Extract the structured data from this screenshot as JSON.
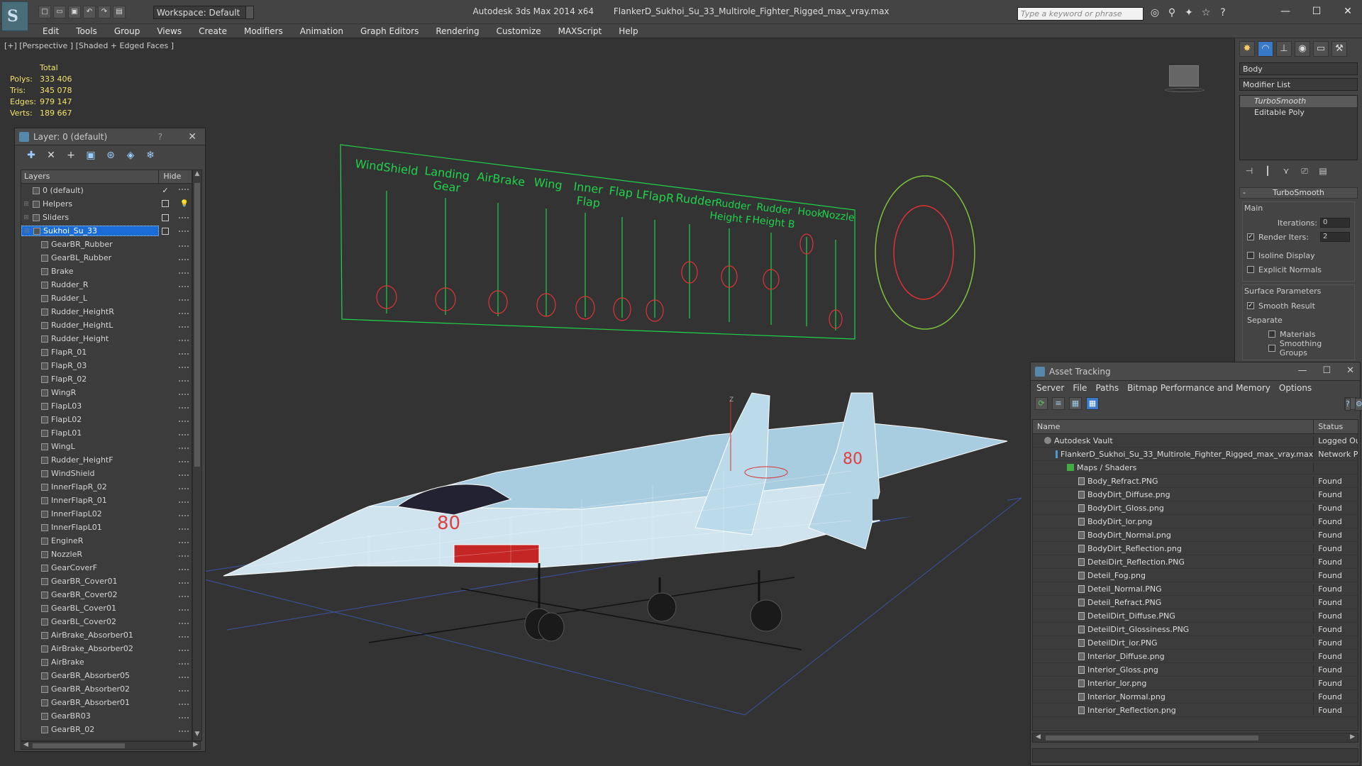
{
  "app": {
    "title": "Autodesk 3ds Max  2014 x64",
    "file": "FlankerD_Sukhoi_Su_33_Multirole_Fighter_Rigged_max_vray.max",
    "workspace": "Workspace: Default",
    "search_placeholder": "Type a keyword or phrase"
  },
  "menu": [
    "Edit",
    "Tools",
    "Group",
    "Views",
    "Create",
    "Modifiers",
    "Animation",
    "Graph Editors",
    "Rendering",
    "Customize",
    "MAXScript",
    "Help"
  ],
  "viewport": {
    "label": "[+] [Perspective ] [Shaded + Edged Faces ]",
    "stats_header": "Total",
    "stats": [
      {
        "k": "Polys:",
        "v": "333 406"
      },
      {
        "k": "Tris:",
        "v": "345 078"
      },
      {
        "k": "Edges:",
        "v": "979 147"
      },
      {
        "k": "Verts:",
        "v": "189 667"
      }
    ],
    "rig_labels": [
      "WindShield",
      "Landing",
      "Gear",
      "AirBrake",
      "Wing",
      "Inner",
      "Flap",
      "Flap L",
      "FlapR",
      "Rudder",
      "Rudder",
      "Height F",
      "Rudder",
      "Height B",
      "Hook",
      "Nozzle"
    ],
    "aircraft_number": "80",
    "axis_label": "Z"
  },
  "layer_panel": {
    "title": "Layer: 0 (default)",
    "help": "?",
    "col_layers": "Layers",
    "col_hide": "Hide",
    "rows": [
      {
        "name": "0 (default)",
        "level": 0,
        "check": "✓",
        "hide": ""
      },
      {
        "name": "Helpers",
        "level": 0,
        "check": "",
        "hide": "bulb"
      },
      {
        "name": "Sliders",
        "level": 0,
        "check": "",
        "hide": ""
      },
      {
        "name": "Sukhoi_Su_33",
        "level": 0,
        "check": "",
        "hide": "",
        "selected": true
      },
      {
        "name": "GearBR_Rubber",
        "level": 1
      },
      {
        "name": "GearBL_Rubber",
        "level": 1
      },
      {
        "name": "Brake",
        "level": 1
      },
      {
        "name": "Rudder_R",
        "level": 1
      },
      {
        "name": "Rudder_L",
        "level": 1
      },
      {
        "name": "Rudder_HeightR",
        "level": 1
      },
      {
        "name": "Rudder_HeightL",
        "level": 1
      },
      {
        "name": "Rudder_Height",
        "level": 1
      },
      {
        "name": "FlapR_01",
        "level": 1
      },
      {
        "name": "FlapR_03",
        "level": 1
      },
      {
        "name": "FlapR_02",
        "level": 1
      },
      {
        "name": "WingR",
        "level": 1
      },
      {
        "name": "FlapL03",
        "level": 1
      },
      {
        "name": "FlapL02",
        "level": 1
      },
      {
        "name": "FlapL01",
        "level": 1
      },
      {
        "name": "WingL",
        "level": 1
      },
      {
        "name": "Rudder_HeightF",
        "level": 1
      },
      {
        "name": "WindShield",
        "level": 1
      },
      {
        "name": "InnerFlapR_02",
        "level": 1
      },
      {
        "name": "InnerFlapR_01",
        "level": 1
      },
      {
        "name": "InnerFlapL02",
        "level": 1
      },
      {
        "name": "InnerFlapL01",
        "level": 1
      },
      {
        "name": "EngineR",
        "level": 1
      },
      {
        "name": "NozzleR",
        "level": 1
      },
      {
        "name": "GearCoverF",
        "level": 1
      },
      {
        "name": "GearBR_Cover01",
        "level": 1
      },
      {
        "name": "GearBR_Cover02",
        "level": 1
      },
      {
        "name": "GearBL_Cover01",
        "level": 1
      },
      {
        "name": "GearBL_Cover02",
        "level": 1
      },
      {
        "name": "AirBrake_Absorber01",
        "level": 1
      },
      {
        "name": "AirBrake_Absorber02",
        "level": 1
      },
      {
        "name": "AirBrake",
        "level": 1
      },
      {
        "name": "GearBR_Absorber05",
        "level": 1
      },
      {
        "name": "GearBR_Absorber02",
        "level": 1
      },
      {
        "name": "GearBR_Absorber01",
        "level": 1
      },
      {
        "name": "GearBR03",
        "level": 1
      },
      {
        "name": "GearBR_02",
        "level": 1
      }
    ]
  },
  "command_panel": {
    "object_name": "Body",
    "modifier_list": "Modifier List",
    "stack": [
      {
        "name": "TurboSmooth",
        "selected": true
      },
      {
        "name": "Editable Poly",
        "selected": false
      }
    ],
    "rollout": "TurboSmooth",
    "main_group": "Main",
    "iterations_label": "Iterations:",
    "iterations_value": "0",
    "render_iters_label": "Render Iters:",
    "render_iters_value": "2",
    "isoline": "Isoline Display",
    "explicit_normals": "Explicit Normals",
    "surface_group": "Surface Parameters",
    "smooth_result": "Smooth Result",
    "separate": "Separate",
    "materials": "Materials",
    "smoothing_groups": "Smoothing Groups"
  },
  "asset_tracking": {
    "title": "Asset Tracking",
    "menu": [
      "Server",
      "File",
      "Paths",
      "Bitmap Performance and Memory",
      "Options"
    ],
    "col_name": "Name",
    "col_status": "Status",
    "rows": [
      {
        "name": "Autodesk Vault",
        "status": "Logged Out",
        "type": "vault",
        "indent": 1
      },
      {
        "name": "FlankerD_Sukhoi_Su_33_Multirole_Fighter_Rigged_max_vray.max",
        "status": "Network Path",
        "type": "max",
        "indent": 2
      },
      {
        "name": "Maps / Shaders",
        "status": "",
        "type": "group",
        "indent": 3
      },
      {
        "name": "Body_Refract.PNG",
        "status": "Found",
        "type": "file",
        "indent": 4
      },
      {
        "name": "BodyDirt_Diffuse.png",
        "status": "Found",
        "type": "file",
        "indent": 4
      },
      {
        "name": "BodyDirt_Gloss.png",
        "status": "Found",
        "type": "file",
        "indent": 4
      },
      {
        "name": "BodyDirt_lor.png",
        "status": "Found",
        "type": "file",
        "indent": 4
      },
      {
        "name": "BodyDirt_Normal.png",
        "status": "Found",
        "type": "file",
        "indent": 4
      },
      {
        "name": "BodyDirt_Reflection.png",
        "status": "Found",
        "type": "file",
        "indent": 4
      },
      {
        "name": "DeteiDirt_Reflection.PNG",
        "status": "Found",
        "type": "file",
        "indent": 4
      },
      {
        "name": "Deteil_Fog.png",
        "status": "Found",
        "type": "file",
        "indent": 4
      },
      {
        "name": "Deteil_Normal.PNG",
        "status": "Found",
        "type": "file",
        "indent": 4
      },
      {
        "name": "Deteil_Refract.PNG",
        "status": "Found",
        "type": "file",
        "indent": 4
      },
      {
        "name": "DeteilDirt_Diffuse.PNG",
        "status": "Found",
        "type": "file",
        "indent": 4
      },
      {
        "name": "DeteilDirt_Glossiness.PNG",
        "status": "Found",
        "type": "file",
        "indent": 4
      },
      {
        "name": "DeteilDirt_ior.PNG",
        "status": "Found",
        "type": "file",
        "indent": 4
      },
      {
        "name": "Interior_Diffuse.png",
        "status": "Found",
        "type": "file",
        "indent": 4
      },
      {
        "name": "Interior_Gloss.png",
        "status": "Found",
        "type": "file",
        "indent": 4
      },
      {
        "name": "Interior_lor.png",
        "status": "Found",
        "type": "file",
        "indent": 4
      },
      {
        "name": "Interior_Normal.png",
        "status": "Found",
        "type": "file",
        "indent": 4
      },
      {
        "name": "Interior_Reflection.png",
        "status": "Found",
        "type": "file",
        "indent": 4
      }
    ]
  },
  "colors": {
    "rig": "#1fd34a",
    "selection": "#1a6dd6",
    "stats": "#f3e26a"
  }
}
